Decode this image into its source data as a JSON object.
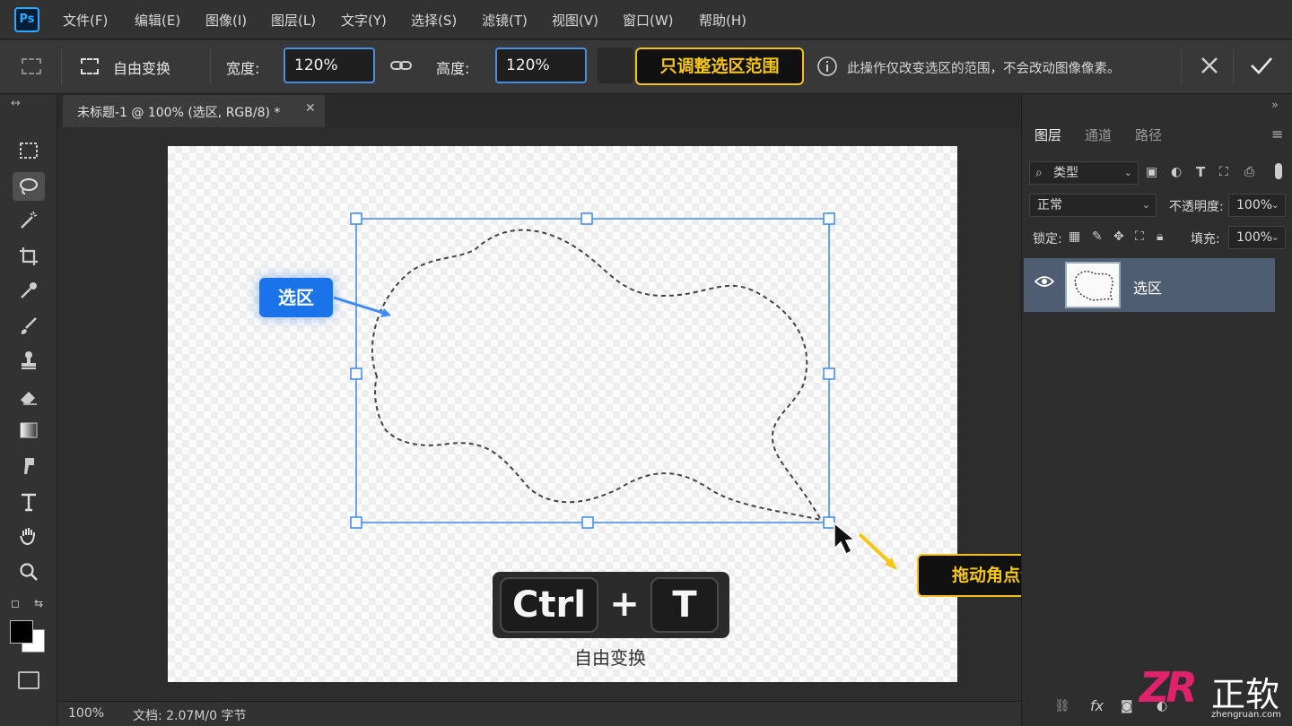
{
  "app": {
    "logo": "Ps"
  },
  "menu": [
    "文件(F)",
    "编辑(E)",
    "图像(I)",
    "图层(L)",
    "文字(Y)",
    "选择(S)",
    "滤镜(T)",
    "视图(V)",
    "窗口(W)",
    "帮助(H)"
  ],
  "options": {
    "mode_label": "自由变换",
    "width_label": "宽度:",
    "width_value": "120%",
    "height_label": "高度:",
    "height_value": "120%",
    "callout": "只调整选区范围",
    "info_text": "此操作仅改变选区的范围，不会改动图像像素。"
  },
  "document": {
    "tab_title": "未标题-1 @ 100% (选区, RGB/8) *",
    "selection_label": "选区",
    "drag_hint": "拖动角点调整选区范围",
    "shortcut_keys": [
      "Ctrl",
      "+",
      "T"
    ],
    "shortcut_caption": "自由变换"
  },
  "status": {
    "zoom": "100%",
    "doc_info": "文档: 2.07M/0 字节"
  },
  "layers_panel": {
    "tabs": [
      "图层",
      "通道",
      "路径"
    ],
    "filter_kind": "类型",
    "blend_mode": "正常",
    "opacity_label": "不透明度:",
    "opacity_value": "100%",
    "lock_label": "锁定:",
    "fill_label": "填充:",
    "fill_value": "100%",
    "layer_name": "选区",
    "footer_fx": "fx"
  },
  "watermark": {
    "brand": "正软",
    "url": "zhengruan.com",
    "logo_letters": "ZR"
  },
  "colors": {
    "accent_blue": "#4a90e2",
    "callout_yellow": "#f5c518",
    "badge_blue": "#1a73e8"
  }
}
